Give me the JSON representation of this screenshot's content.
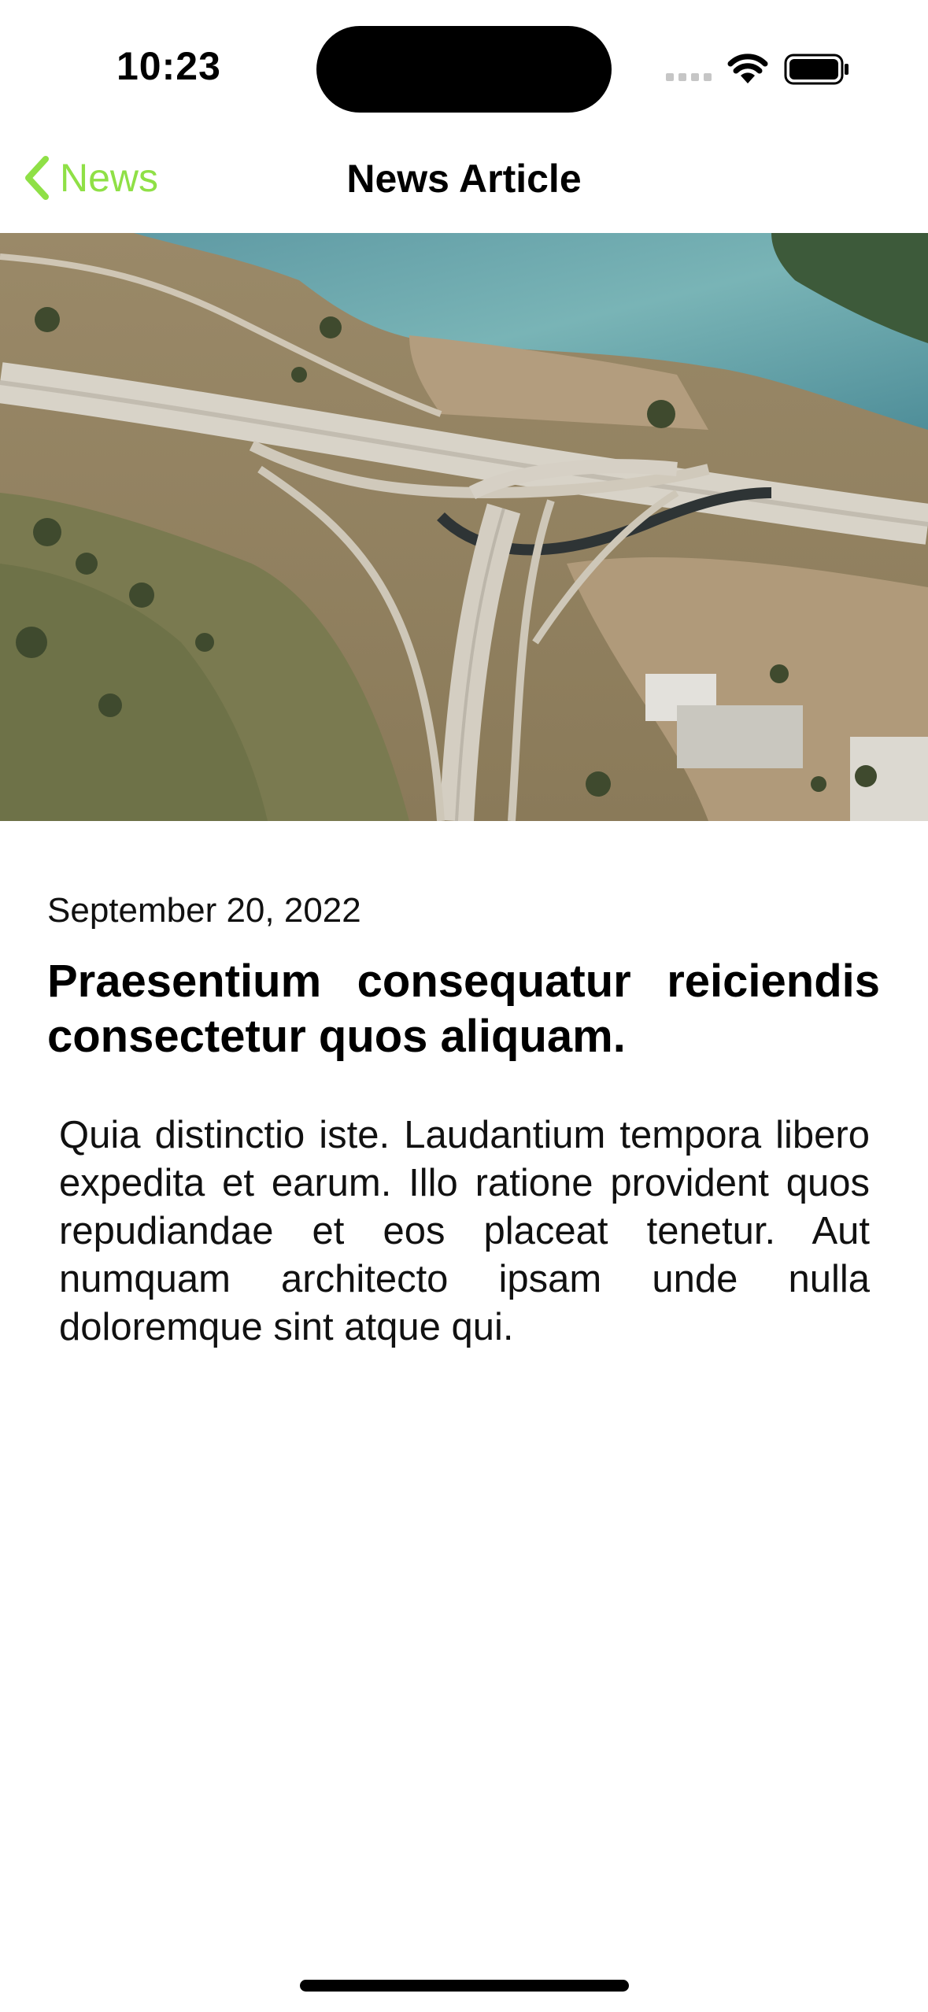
{
  "status_bar": {
    "time": "10:23",
    "icons": [
      "signal-icon",
      "wifi-icon",
      "battery-icon"
    ]
  },
  "nav": {
    "back_label": "News",
    "title": "News Article",
    "accent_color": "#8fe046"
  },
  "hero_image": {
    "description_icon": "aerial-highway-photo"
  },
  "article": {
    "date": "September 20, 2022",
    "title": "Praesentium consequatur reiciendis consectetur quos aliquam.",
    "body": "Quia distinctio iste. Laudantium tempora libero expedita et earum. Illo ratione provident quos repudiandae et eos placeat tenetur. Aut numquam architecto ipsam unde nulla doloremque sint atque qui."
  }
}
